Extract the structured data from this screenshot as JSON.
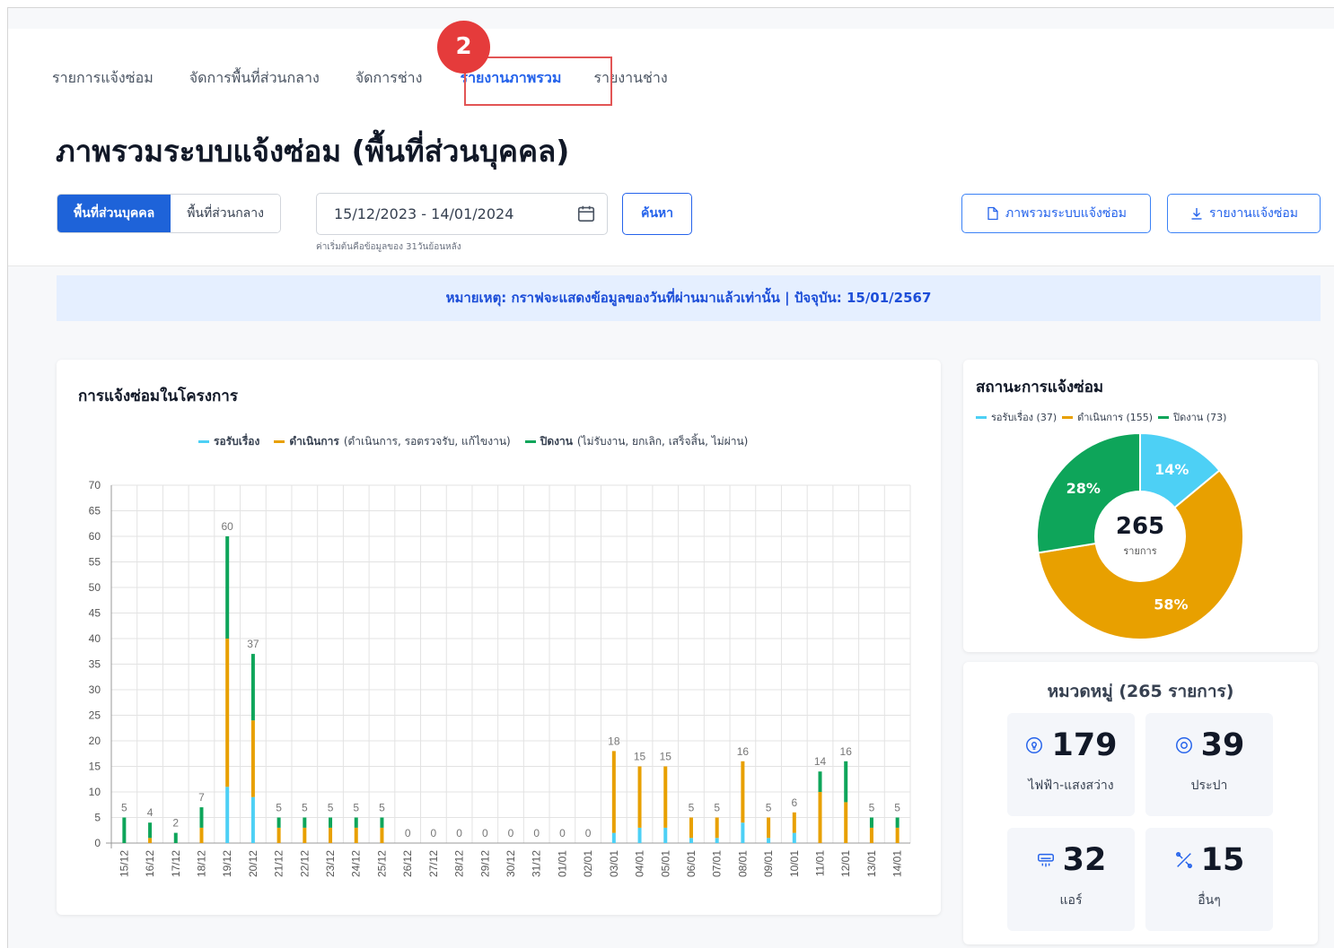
{
  "tabs": [
    {
      "label": "รายการแจ้งซ่อม",
      "active": false
    },
    {
      "label": "จัดการพื้นที่ส่วนกลาง",
      "active": false
    },
    {
      "label": "จัดการช่าง",
      "active": false
    },
    {
      "label": "รายงานภาพรวม",
      "active": true
    },
    {
      "label": "รายงานช่าง",
      "active": false
    }
  ],
  "step_badge": "2",
  "page_title": "ภาพรวมระบบแจ้งซ่อม (พื้นที่ส่วนบุคคล)",
  "area_toggle": {
    "private_label": "พื้นที่ส่วนบุคคล",
    "common_label": "พื้นที่ส่วนกลาง",
    "selected": "private"
  },
  "date_range": {
    "value": "15/12/2023 - 14/01/2024",
    "hint": "ค่าเริ่มต้นคือข้อมูลของ 31วันย้อนหลัง"
  },
  "search_label": "ค้นหา",
  "export_buttons": {
    "overview_label": "ภาพรวมระบบแจ้งซ่อม",
    "report_label": "รายงานแจ้งซ่อม"
  },
  "note": "หมายเหตุ: กราฟจะแสดงข้อมูลของวันที่ผ่านมาแล้วเท่านั้น | ปัจจุบัน: 15/01/2567",
  "colors": {
    "pending": "#4dd0f5",
    "in_progress": "#e8a000",
    "closed": "#0ea55a",
    "accent": "#1e63d9",
    "highlight": "#e53b3b"
  },
  "bar_chart": {
    "title": "การแจ้งซ่อมในโครงการ",
    "legend": [
      {
        "name": "รอรับเรื่อง",
        "detail": ""
      },
      {
        "name": "ดำเนินการ",
        "detail": "(ดำเนินการ, รอตรวจรับ, แก้ไขงาน)"
      },
      {
        "name": "ปิดงาน",
        "detail": "(ไม่รับงาน, ยกเลิก, เสร็จสิ้น, ไม่ผ่าน)"
      }
    ]
  },
  "chart_data": [
    {
      "type": "bar",
      "stacked": true,
      "title": "การแจ้งซ่อมในโครงการ",
      "categories": [
        "15/12",
        "16/12",
        "17/12",
        "18/12",
        "19/12",
        "20/12",
        "21/12",
        "22/12",
        "23/12",
        "24/12",
        "25/12",
        "26/12",
        "27/12",
        "28/12",
        "29/12",
        "30/12",
        "31/12",
        "01/01",
        "02/01",
        "03/01",
        "04/01",
        "05/01",
        "06/01",
        "07/01",
        "08/01",
        "09/01",
        "10/01",
        "11/01",
        "12/01",
        "13/01",
        "14/01"
      ],
      "totals": [
        5,
        4,
        2,
        7,
        60,
        37,
        5,
        5,
        5,
        5,
        5,
        0,
        0,
        0,
        0,
        0,
        0,
        0,
        0,
        18,
        15,
        15,
        5,
        5,
        16,
        5,
        6,
        14,
        16,
        5,
        5
      ],
      "series": [
        {
          "name": "รอรับเรื่อง",
          "values": [
            0,
            0,
            0,
            0,
            11,
            9,
            0,
            0,
            0,
            0,
            0,
            0,
            0,
            0,
            0,
            0,
            0,
            0,
            0,
            2,
            3,
            3,
            1,
            1,
            4,
            1,
            2,
            0,
            0,
            0,
            0
          ]
        },
        {
          "name": "ดำเนินการ",
          "values": [
            0,
            1,
            0,
            3,
            29,
            15,
            3,
            3,
            3,
            3,
            3,
            0,
            0,
            0,
            0,
            0,
            0,
            0,
            0,
            16,
            12,
            12,
            4,
            4,
            12,
            4,
            4,
            10,
            8,
            3,
            3
          ]
        },
        {
          "name": "ปิดงาน",
          "values": [
            5,
            3,
            2,
            4,
            20,
            13,
            2,
            2,
            2,
            2,
            2,
            0,
            0,
            0,
            0,
            0,
            0,
            0,
            0,
            0,
            0,
            0,
            0,
            0,
            0,
            0,
            0,
            4,
            8,
            2,
            2
          ]
        }
      ],
      "ylim": [
        0,
        70
      ],
      "yticks": [
        0,
        5,
        10,
        15,
        20,
        25,
        30,
        35,
        40,
        45,
        50,
        55,
        60,
        65,
        70
      ],
      "grid": true,
      "legend_position": "top"
    },
    {
      "type": "pie",
      "donut": true,
      "title": "สถานะการแจ้งซ่อม",
      "labels": [
        "รอรับเรื่อง",
        "ดำเนินการ",
        "ปิดงาน"
      ],
      "values": [
        37,
        155,
        73
      ],
      "percent_labels": [
        "14%",
        "58%",
        "28%"
      ],
      "center_value": "265",
      "center_label": "รายการ",
      "legend_position": "top-left"
    }
  ],
  "status_card": {
    "title": "สถานะการแจ้งซ่อม",
    "legend": [
      "รอรับเรื่อง (37)",
      "ดำเนินการ (155)",
      "ปิดงาน (73)"
    ]
  },
  "category_card": {
    "title": "หมวดหมู่ (265 รายการ)",
    "items": [
      {
        "count": "179",
        "label": "ไฟฟ้า-แสงสว่าง",
        "icon": "bulb-icon"
      },
      {
        "count": "39",
        "label": "ประปา",
        "icon": "water-drop-icon"
      },
      {
        "count": "32",
        "label": "แอร์",
        "icon": "air-conditioner-icon"
      },
      {
        "count": "15",
        "label": "อื่นๆ",
        "icon": "tools-icon"
      }
    ]
  }
}
